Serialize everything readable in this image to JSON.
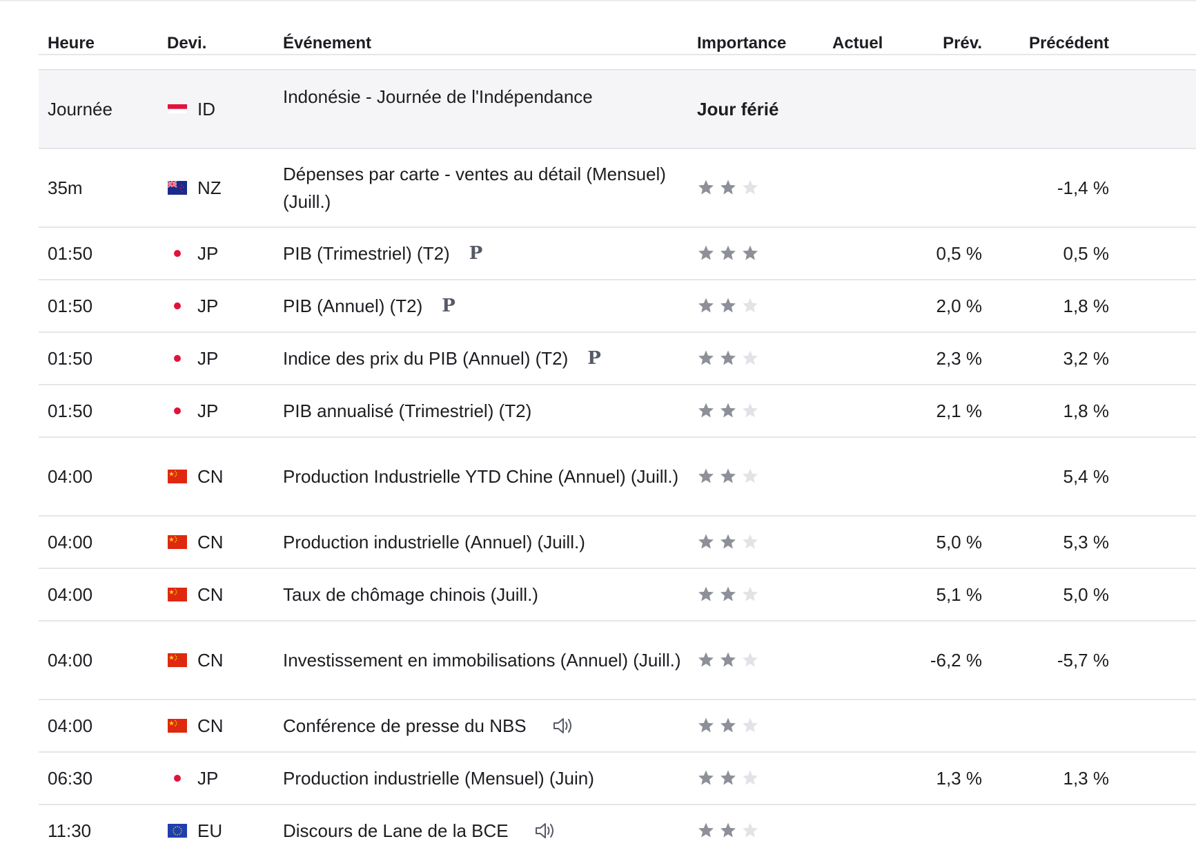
{
  "columns": {
    "time": "Heure",
    "currency": "Devi.",
    "event": "Événement",
    "importance": "Importance",
    "actual": "Actuel",
    "forecast": "Prév.",
    "previous": "Précédent"
  },
  "holiday": {
    "time": "Journée",
    "currency": "ID",
    "flag": "indonesia-flag",
    "event": "Indonésie - Journée de l'Indépendance",
    "label": "Jour férié"
  },
  "events": [
    {
      "time": "35m",
      "currency": "NZ",
      "flag": "new-zealand-flag",
      "event": "Dépenses par carte - ventes au détail (Mensuel) (Juill.)",
      "importance": 2,
      "actual": "",
      "forecast": "",
      "previous": "-1,4 %",
      "prelim": "",
      "speech": false
    },
    {
      "time": "01:50",
      "currency": "JP",
      "flag": "japan-flag",
      "event": "PIB (Trimestriel) (T2)",
      "importance": 3,
      "actual": "",
      "forecast": "0,5 %",
      "previous": "0,5 %",
      "prelim": "P",
      "speech": false
    },
    {
      "time": "01:50",
      "currency": "JP",
      "flag": "japan-flag",
      "event": "PIB (Annuel) (T2)",
      "importance": 2,
      "actual": "",
      "forecast": "2,0 %",
      "previous": "1,8 %",
      "prelim": "P",
      "speech": false
    },
    {
      "time": "01:50",
      "currency": "JP",
      "flag": "japan-flag",
      "event": "Indice des prix du PIB (Annuel) (T2)",
      "importance": 2,
      "actual": "",
      "forecast": "2,3 %",
      "previous": "3,2 %",
      "prelim": "P",
      "speech": false
    },
    {
      "time": "01:50",
      "currency": "JP",
      "flag": "japan-flag",
      "event": "PIB annualisé (Trimestriel) (T2)",
      "importance": 2,
      "actual": "",
      "forecast": "2,1 %",
      "previous": "1,8 %",
      "prelim": "",
      "speech": false
    },
    {
      "time": "04:00",
      "currency": "CN",
      "flag": "china-flag",
      "event": "Production Industrielle YTD Chine (Annuel) (Juill.)",
      "importance": 2,
      "actual": "",
      "forecast": "",
      "previous": "5,4 %",
      "prelim": "",
      "speech": false
    },
    {
      "time": "04:00",
      "currency": "CN",
      "flag": "china-flag",
      "event": "Production industrielle (Annuel) (Juill.)",
      "importance": 2,
      "actual": "",
      "forecast": "5,0 %",
      "previous": "5,3 %",
      "prelim": "",
      "speech": false
    },
    {
      "time": "04:00",
      "currency": "CN",
      "flag": "china-flag",
      "event": "Taux de chômage chinois  (Juill.)",
      "importance": 2,
      "actual": "",
      "forecast": "5,1 %",
      "previous": "5,0 %",
      "prelim": "",
      "speech": false
    },
    {
      "time": "04:00",
      "currency": "CN",
      "flag": "china-flag",
      "event": "Investissement en immobilisations (Annuel) (Juill.)",
      "importance": 2,
      "actual": "",
      "forecast": "-6,2 %",
      "previous": "-5,7 %",
      "prelim": "",
      "speech": false
    },
    {
      "time": "04:00",
      "currency": "CN",
      "flag": "china-flag",
      "event": "Conférence de presse du NBS",
      "importance": 2,
      "actual": "",
      "forecast": "",
      "previous": "",
      "prelim": "",
      "speech": true
    },
    {
      "time": "06:30",
      "currency": "JP",
      "flag": "japan-flag",
      "event": "Production industrielle (Mensuel) (Juin)",
      "importance": 2,
      "actual": "",
      "forecast": "1,3 %",
      "previous": "1,3 %",
      "prelim": "",
      "speech": false
    },
    {
      "time": "11:30",
      "currency": "EU",
      "flag": "eu-flag",
      "event": "Discours de Lane de la BCE",
      "importance": 2,
      "actual": "",
      "forecast": "",
      "previous": "",
      "prelim": "",
      "speech": true
    }
  ],
  "colors": {
    "star_on": "#8e9099",
    "star_off": "#e2e3e7",
    "row_separator": "#e6e6ea",
    "holiday_background": "#f5f5f7",
    "text": "#1d1d22"
  }
}
